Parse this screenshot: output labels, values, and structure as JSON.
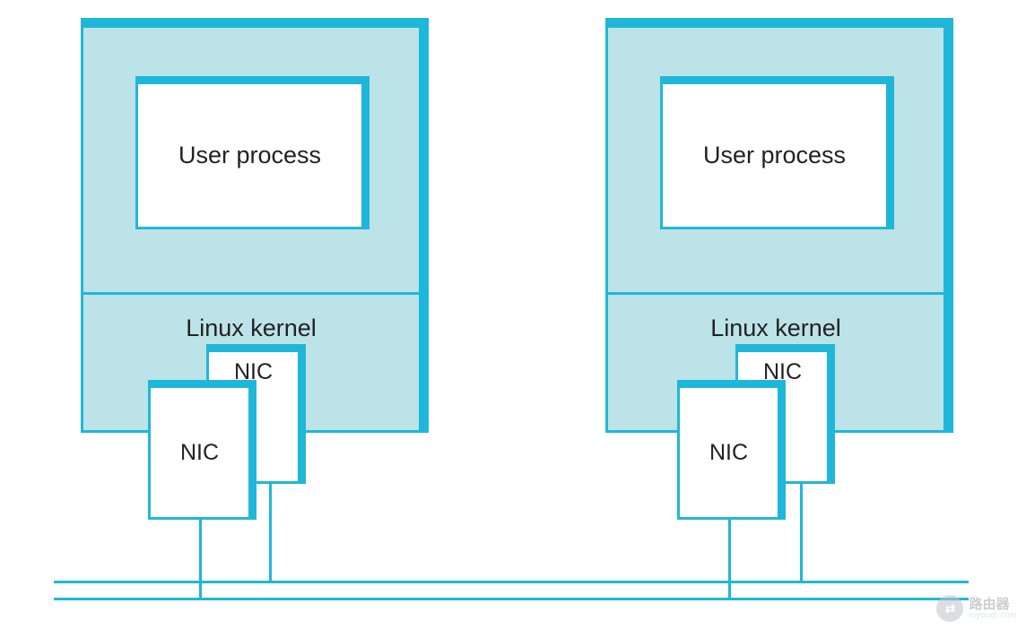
{
  "nodes": {
    "left": {
      "user_process": "User process",
      "kernel": "Linux kernel",
      "nic_back": "NIC",
      "nic_front": "NIC"
    },
    "right": {
      "user_process": "User process",
      "kernel": "Linux kernel",
      "nic_back": "NIC",
      "nic_front": "NIC"
    }
  },
  "watermark": {
    "icon": "⇄",
    "title": "路由器",
    "sub": "luyouqi.com"
  },
  "colors": {
    "stroke": "#1fb7d9",
    "fill": "#bce3e8",
    "box": "#ffffff"
  }
}
